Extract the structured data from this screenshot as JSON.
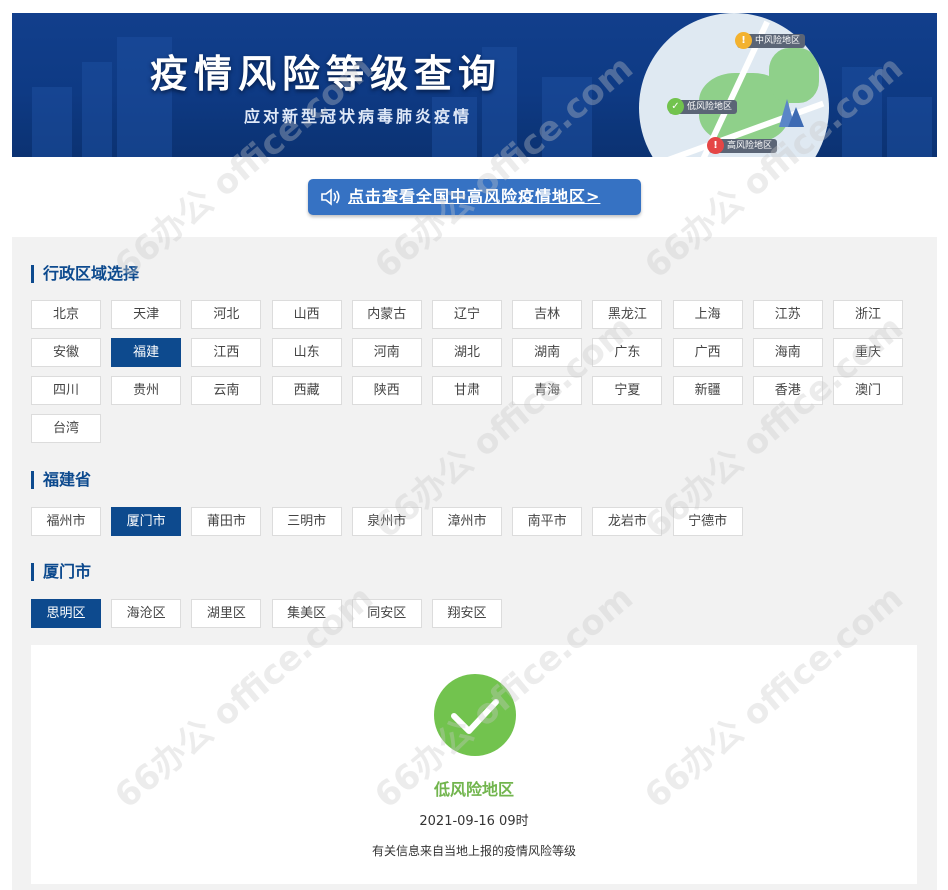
{
  "banner": {
    "title": "疫情风险等级查询",
    "subtitle": "应对新型冠状病毒肺炎疫情",
    "map_pins": {
      "medium": "中风险地区",
      "low": "低风险地区",
      "high": "高风险地区"
    }
  },
  "notice": {
    "label": "点击查看全国中高风险疫情地区>"
  },
  "region_section": {
    "title": "行政区域选择",
    "provinces": [
      "北京",
      "天津",
      "河北",
      "山西",
      "内蒙古",
      "辽宁",
      "吉林",
      "黑龙江",
      "上海",
      "江苏",
      "浙江",
      "安徽",
      "福建",
      "江西",
      "山东",
      "河南",
      "湖北",
      "湖南",
      "广东",
      "广西",
      "海南",
      "重庆",
      "四川",
      "贵州",
      "云南",
      "西藏",
      "陕西",
      "甘肃",
      "青海",
      "宁夏",
      "新疆",
      "香港",
      "澳门",
      "台湾"
    ],
    "selected": "福建"
  },
  "city_section": {
    "title": "福建省",
    "cities": [
      "福州市",
      "厦门市",
      "莆田市",
      "三明市",
      "泉州市",
      "漳州市",
      "南平市",
      "龙岩市",
      "宁德市"
    ],
    "selected": "厦门市"
  },
  "district_section": {
    "title": "厦门市",
    "districts": [
      "思明区",
      "海沧区",
      "湖里区",
      "集美区",
      "同安区",
      "翔安区"
    ],
    "selected": "思明区"
  },
  "result": {
    "level": "低风险地区",
    "time": "2021-09-16 09时",
    "note": "有关信息来自当地上报的疫情风险等级"
  },
  "colors": {
    "accent": "#0d4a8e",
    "low_risk": "#72c34e",
    "medium_risk": "#f3b22f",
    "high_risk": "#e54646"
  },
  "watermark": "66办公 office.com"
}
